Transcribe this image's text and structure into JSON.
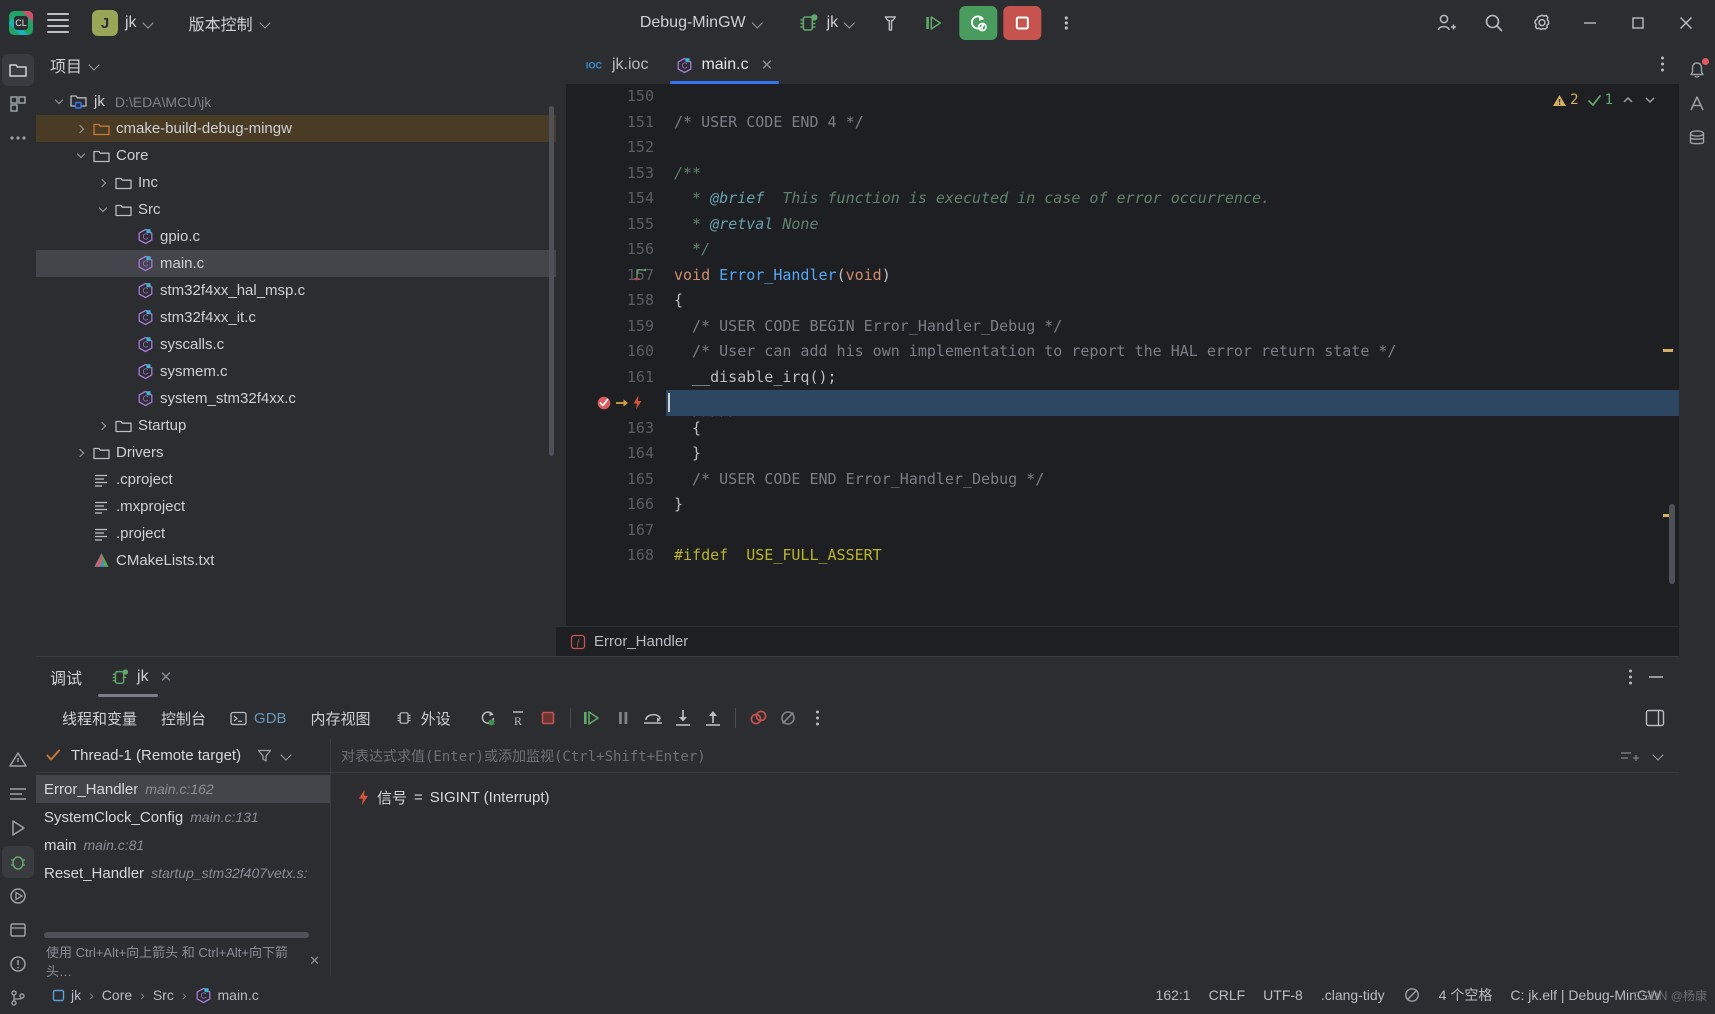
{
  "titlebar": {
    "menu_icon": "hamburger-icon",
    "project_initial": "J",
    "project_name": "jk",
    "vcs_label": "版本控制",
    "config_name": "Debug-MinGW",
    "run_target": "jk",
    "icons": {
      "build": "hammer-icon",
      "run": "run-icon",
      "debug_restart": "rerun-debug-icon",
      "stop": "stop-icon",
      "more": "more-vertical-icon",
      "add_user": "add-user-icon",
      "search": "search-icon",
      "settings": "gear-icon",
      "minimize": "minimize-icon",
      "maximize": "maximize-icon",
      "close": "close-icon"
    }
  },
  "project_panel": {
    "title": "项目",
    "tree": [
      {
        "label": "jk",
        "path": "D:\\EDA\\MCU\\jk",
        "indent": 0,
        "arrow": "down",
        "icon": "module-folder-icon",
        "state": "normal"
      },
      {
        "label": "cmake-build-debug-mingw",
        "path": "",
        "indent": 1,
        "arrow": "right",
        "icon": "excluded-folder-icon",
        "state": "highlight"
      },
      {
        "label": "Core",
        "path": "",
        "indent": 1,
        "arrow": "down",
        "icon": "folder-icon",
        "state": "normal"
      },
      {
        "label": "Inc",
        "path": "",
        "indent": 2,
        "arrow": "right",
        "icon": "folder-icon",
        "state": "normal"
      },
      {
        "label": "Src",
        "path": "",
        "indent": 2,
        "arrow": "down",
        "icon": "folder-icon",
        "state": "normal"
      },
      {
        "label": "gpio.c",
        "path": "",
        "indent": 3,
        "arrow": "none",
        "icon": "c-file-icon",
        "state": "normal"
      },
      {
        "label": "main.c",
        "path": "",
        "indent": 3,
        "arrow": "none",
        "icon": "c-file-icon",
        "state": "selected"
      },
      {
        "label": "stm32f4xx_hal_msp.c",
        "path": "",
        "indent": 3,
        "arrow": "none",
        "icon": "c-file-icon",
        "state": "normal"
      },
      {
        "label": "stm32f4xx_it.c",
        "path": "",
        "indent": 3,
        "arrow": "none",
        "icon": "c-file-icon",
        "state": "normal"
      },
      {
        "label": "syscalls.c",
        "path": "",
        "indent": 3,
        "arrow": "none",
        "icon": "c-file-icon",
        "state": "normal"
      },
      {
        "label": "sysmem.c",
        "path": "",
        "indent": 3,
        "arrow": "none",
        "icon": "c-file-icon",
        "state": "normal"
      },
      {
        "label": "system_stm32f4xx.c",
        "path": "",
        "indent": 3,
        "arrow": "none",
        "icon": "c-file-icon",
        "state": "normal"
      },
      {
        "label": "Startup",
        "path": "",
        "indent": 2,
        "arrow": "right",
        "icon": "folder-icon",
        "state": "normal"
      },
      {
        "label": "Drivers",
        "path": "",
        "indent": 1,
        "arrow": "right",
        "icon": "folder-icon",
        "state": "normal"
      },
      {
        "label": ".cproject",
        "path": "",
        "indent": 1,
        "arrow": "none",
        "icon": "text-file-icon",
        "state": "normal"
      },
      {
        "label": ".mxproject",
        "path": "",
        "indent": 1,
        "arrow": "none",
        "icon": "text-file-icon",
        "state": "normal"
      },
      {
        "label": ".project",
        "path": "",
        "indent": 1,
        "arrow": "none",
        "icon": "text-file-icon",
        "state": "normal"
      },
      {
        "label": "CMakeLists.txt",
        "path": "",
        "indent": 1,
        "arrow": "none",
        "icon": "cmake-file-icon",
        "state": "normal"
      }
    ]
  },
  "editor": {
    "tabs": [
      {
        "label": "jk.ioc",
        "icon": "ioc-file-icon",
        "active": false,
        "closable": false
      },
      {
        "label": "main.c",
        "icon": "c-file-icon",
        "active": true,
        "closable": true
      }
    ],
    "inspections": {
      "warning_count": "2",
      "ok_count": "1"
    },
    "breadcrumb": "Error_Handler",
    "first_line": 150,
    "current_line": 162,
    "lines": [
      {
        "n": 150,
        "text": ""
      },
      {
        "n": 151,
        "text": "/* USER CODE END 4 */",
        "kind": "comment"
      },
      {
        "n": 152,
        "text": ""
      },
      {
        "n": 153,
        "text": "/**",
        "kind": "doc"
      },
      {
        "n": 154,
        "text": "  * @brief  This function is executed in case of error occurrence.",
        "kind": "doc-tag",
        "tag": "@brief"
      },
      {
        "n": 155,
        "text": "  * @retval None",
        "kind": "doc-tag",
        "tag": "@retval"
      },
      {
        "n": 156,
        "text": "  */",
        "kind": "doc"
      },
      {
        "n": 157,
        "text": "void Error_Handler(void)",
        "kind": "signature",
        "gutter_icon": "implemented-arrow-icon"
      },
      {
        "n": 158,
        "text": "{",
        "kind": "plain"
      },
      {
        "n": 159,
        "text": "  /* USER CODE BEGIN Error_Handler_Debug */",
        "kind": "comment"
      },
      {
        "n": 160,
        "text": "  /* User can add his own implementation to report the HAL error return state */",
        "kind": "comment"
      },
      {
        "n": 161,
        "text": "  __disable_irq();",
        "kind": "plain"
      },
      {
        "n": 162,
        "text": "  while (1)",
        "kind": "current",
        "gutter_icon": "breakpoint-hit-icon"
      },
      {
        "n": 163,
        "text": "  {",
        "kind": "plain"
      },
      {
        "n": 164,
        "text": "  }",
        "kind": "plain"
      },
      {
        "n": 165,
        "text": "  /* USER CODE END Error_Handler_Debug */",
        "kind": "comment"
      },
      {
        "n": 166,
        "text": "}",
        "kind": "plain"
      },
      {
        "n": 167,
        "text": ""
      },
      {
        "n": 168,
        "text": "#ifdef  USE_FULL_ASSERT",
        "kind": "preproc"
      }
    ]
  },
  "debug_panel": {
    "title": "调试",
    "session_tab": "jk",
    "tabs": [
      {
        "label": "线程和变量",
        "icon": "",
        "active": true
      },
      {
        "label": "控制台",
        "icon": "",
        "active": false
      },
      {
        "label": "GDB",
        "icon": "terminal-icon",
        "active": false
      },
      {
        "label": "内存视图",
        "icon": "",
        "active": false
      },
      {
        "label": "外设",
        "icon": "chip-icon",
        "active": false
      }
    ],
    "toolbar_icons": [
      "reset-debug-icon",
      "show-registers-icon",
      "stop-icon",
      "resume-icon",
      "pause-icon",
      "step-over-icon",
      "step-into-icon",
      "step-out-icon",
      "view-breakpoints-icon",
      "mute-breakpoints-icon",
      "more-vertical-icon"
    ],
    "thread": {
      "name": "Thread-1 (Remote target)",
      "filter_icon": "filter-icon",
      "dropdown_icon": "chevron-down-icon"
    },
    "frames": [
      {
        "fn": "Error_Handler",
        "loc": "main.c:162",
        "selected": true
      },
      {
        "fn": "SystemClock_Config",
        "loc": "main.c:131",
        "selected": false
      },
      {
        "fn": "main",
        "loc": "main.c:81",
        "selected": false
      },
      {
        "fn": "Reset_Handler",
        "loc": "startup_stm32f407vetx.s:",
        "selected": false
      }
    ],
    "hint": "使用 Ctrl+Alt+向上箭头 和 Ctrl+Alt+向下箭头…",
    "eval_placeholder": "对表达式求值(Enter)或添加监视(Ctrl+Shift+Enter)",
    "variables": [
      {
        "icon": "signal-icon",
        "label": "信号",
        "eq": "=",
        "value": "SIGINT (Interrupt)"
      }
    ]
  },
  "status_bar": {
    "breadcrumbs": [
      {
        "label": "jk",
        "icon": "module-icon"
      },
      {
        "label": "Core",
        "icon": ""
      },
      {
        "label": "Src",
        "icon": ""
      },
      {
        "label": "main.c",
        "icon": "c-file-icon"
      }
    ],
    "right": [
      {
        "label": "162:1",
        "name": "caret-position"
      },
      {
        "label": "CRLF",
        "name": "line-separator"
      },
      {
        "label": "UTF-8",
        "name": "file-encoding"
      },
      {
        "label": ".clang-tidy",
        "name": "clang-tidy-config"
      },
      {
        "label": "",
        "name": "inspections-widget"
      },
      {
        "label": "4 个空格",
        "name": "indent-width"
      },
      {
        "label": "C: jk.elf | Debug-MinGW",
        "name": "build-target"
      }
    ]
  },
  "colors": {
    "accent_blue": "#3574f0",
    "green": "#4a9c5e",
    "red": "#c7534f",
    "panel_bg": "#2b2d30",
    "editor_bg": "#1e1f22"
  }
}
